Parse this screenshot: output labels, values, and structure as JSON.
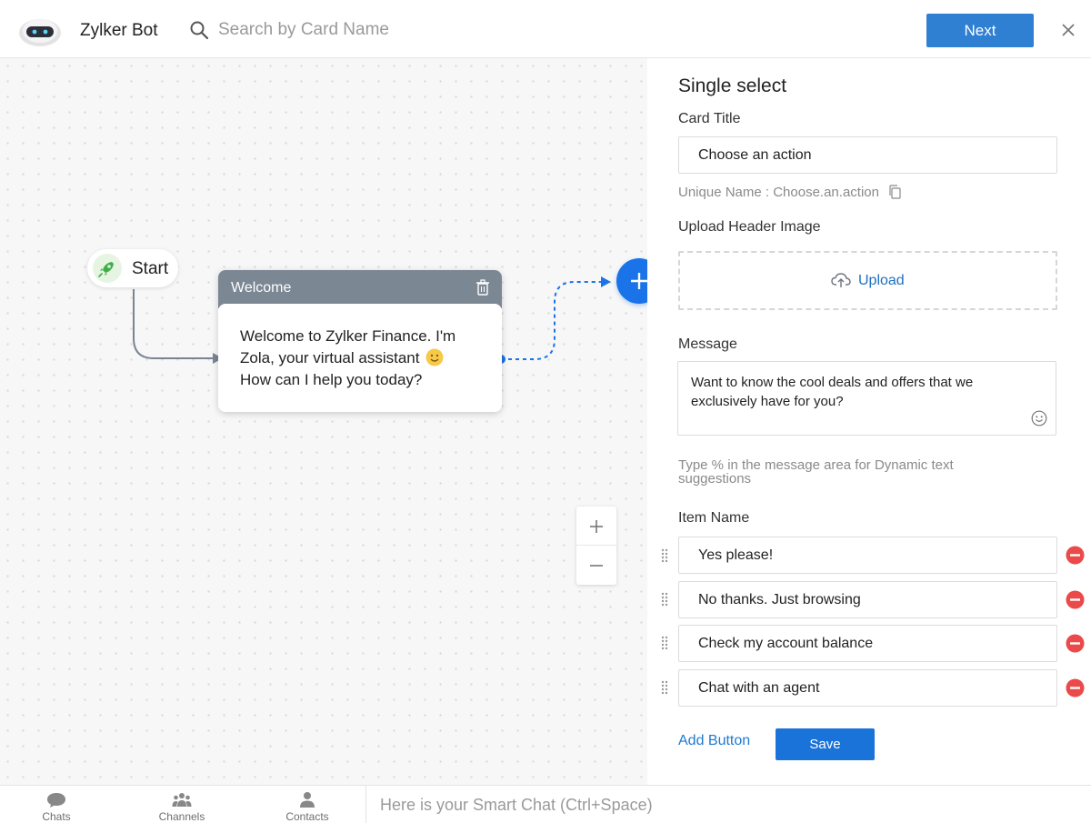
{
  "header": {
    "bot_name": "Zylker Bot",
    "search_placeholder": "Search by Card Name",
    "next_label": "Next"
  },
  "canvas": {
    "start_label": "Start",
    "welcome_card": {
      "title": "Welcome",
      "message": "Welcome to Zylker Finance. I'm Zola, your virtual assistant",
      "message_line2": "How can I help you today?"
    }
  },
  "panel": {
    "title": "Single select",
    "card_title_label": "Card Title",
    "card_title_value": "Choose an action",
    "unique_name": "Unique Name : Choose.an.action",
    "upload_header_label": "Upload Header Image",
    "upload_label": "Upload",
    "message_label": "Message",
    "message_value": "Want to know the cool deals and offers that we exclusively have for you?",
    "hint": "Type % in the message area for Dynamic text suggestions",
    "item_name_label": "Item Name",
    "items": [
      "Yes please!",
      "No thanks. Just browsing",
      "Check my account balance",
      "Chat with an agent"
    ],
    "add_button_label": "Add Button",
    "save_label": "Save"
  },
  "bottombar": {
    "tabs": [
      {
        "label": "Chats",
        "icon": "chat-bubble-icon"
      },
      {
        "label": "Channels",
        "icon": "channels-icon"
      },
      {
        "label": "Contacts",
        "icon": "contacts-icon"
      }
    ],
    "smart_chat_placeholder": "Here is your Smart Chat (Ctrl+Space)"
  },
  "colors": {
    "primary": "#2f7fd3",
    "add_node": "#1a73e8",
    "card_header": "#7c8794",
    "remove": "#ea4a4a",
    "link": "#1f7ad1"
  }
}
